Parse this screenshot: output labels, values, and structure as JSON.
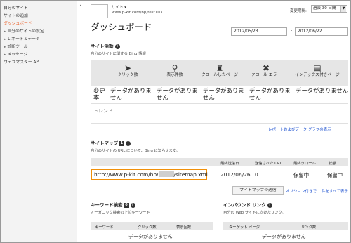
{
  "sidebar": {
    "items": [
      {
        "label": "自分のサイト",
        "arrow": false,
        "active": false
      },
      {
        "label": "サイトの追加",
        "arrow": false,
        "active": false
      },
      {
        "label": "ダッシュボード",
        "arrow": false,
        "active": true
      },
      {
        "label": "自分のサイトの設定",
        "arrow": true,
        "active": false
      },
      {
        "label": "レポート＆データ",
        "arrow": true,
        "active": false
      },
      {
        "label": "診断ツール",
        "arrow": true,
        "active": false
      },
      {
        "label": "メッセージ",
        "arrow": true,
        "active": false
      },
      {
        "label": "ウェブマスター API",
        "arrow": false,
        "active": false
      }
    ],
    "collapse_glyph": "‹"
  },
  "header": {
    "site_label": "サイト ▾",
    "site_url": "www.p-kit.com/hp/test103",
    "title": "ダッシュボード",
    "period_label": "変更期間:",
    "period_value": "過去 30 日間",
    "date_from": "2012/05/23",
    "date_sep": "-",
    "date_to": "2012/06/22"
  },
  "activity": {
    "title": "サイト活動",
    "subtitle": "自分のサイトに関する Bing 情報",
    "columns": [
      {
        "icon": "cursor-icon",
        "glyph": "➤",
        "label": "クリック数"
      },
      {
        "icon": "search-icon",
        "glyph": "⚲",
        "label": "表示件数"
      },
      {
        "icon": "robot-icon",
        "glyph": "♜",
        "label": "クロールしたページ"
      },
      {
        "icon": "crawl-error-icon",
        "glyph": "✖",
        "label": "クロール エラー"
      },
      {
        "icon": "index-icon",
        "glyph": "▤",
        "label": "インデックス付きページ"
      }
    ],
    "metric_label": "変更率",
    "no_data": "データがありません",
    "trend_label": "トレンド",
    "reports_link": "レポートおよびデータ グラフの表示"
  },
  "sitemap": {
    "title": "サイトマップ",
    "count": "1",
    "subtitle": "自分のサイトの URL について、Bing に知らせます。",
    "headers": [
      "最終送信日",
      "送信された URL",
      "最終クロール",
      "状態"
    ],
    "url_prefix": "http://www.p-kit.com/hp/",
    "url_suffix": "/sitemap.xml",
    "last_submitted": "2012/06/26",
    "urls_submitted": "0",
    "last_crawl": "保留中",
    "status": "保留中",
    "submit_button": "サイトマップの送信",
    "see_all_link": "オプション付きで 1 件をすべて表示"
  },
  "keywords": {
    "title": "キーワード検索",
    "count": "0",
    "subtitle": "オーガニック検索の上位キーワード",
    "headers": [
      "キーワード",
      "クリック数",
      "表示回数"
    ],
    "empty": "データがありません"
  },
  "inbound": {
    "title": "インバウンド リンク",
    "subtitle": "自分の Web サイトに向けたリンク。",
    "headers": [
      "ターゲット ページ",
      "リンク数"
    ],
    "empty": "データがありません"
  }
}
